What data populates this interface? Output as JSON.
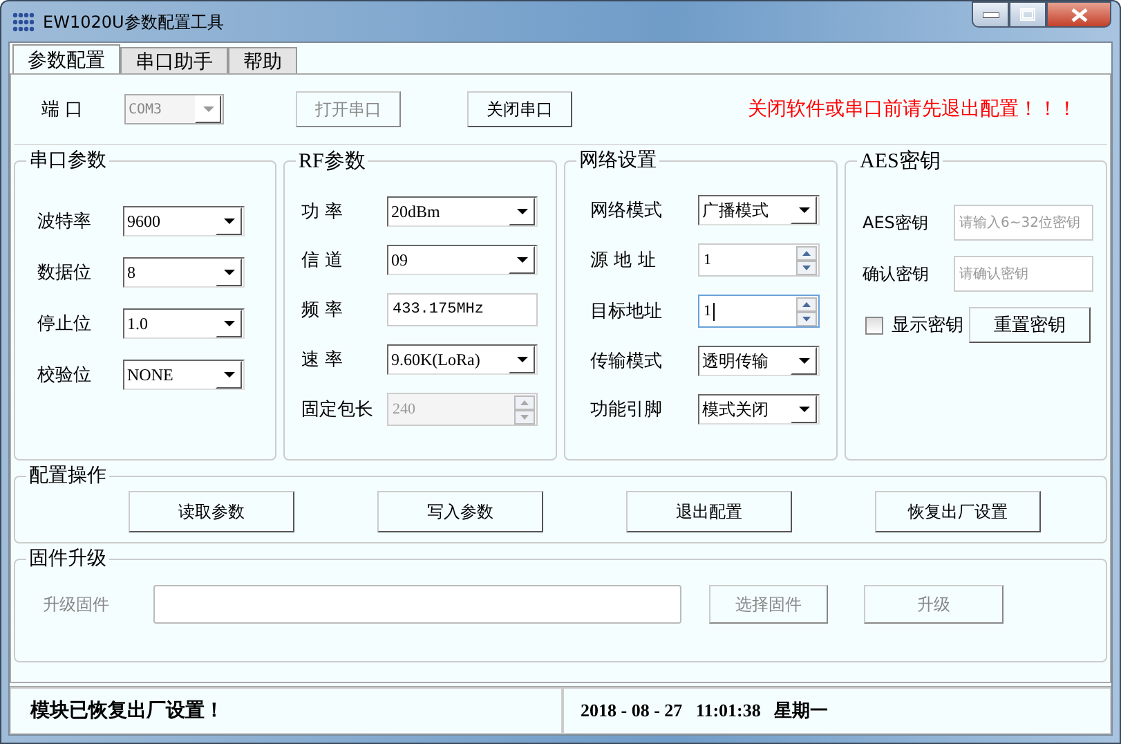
{
  "window": {
    "title": "EW1020U参数配置工具"
  },
  "tabs": [
    {
      "label": "参数配置",
      "selected": true
    },
    {
      "label": "串口助手",
      "selected": false
    },
    {
      "label": "帮助",
      "selected": false
    }
  ],
  "port": {
    "label": "端 口",
    "value": "COM3",
    "disabled": true
  },
  "port_buttons": [
    {
      "label": "打开串口",
      "disabled": true
    },
    {
      "label": "关闭串口",
      "disabled": false
    }
  ],
  "warning": "关闭软件或串口前请先退出配置！！！",
  "groups": [
    {
      "title": "串口参数",
      "fields": [
        {
          "label": "波特率",
          "kind": "select",
          "value": "9600",
          "disabled": false
        },
        {
          "label": "数据位",
          "kind": "select",
          "value": "8",
          "disabled": false
        },
        {
          "label": "停止位",
          "kind": "select",
          "value": "1.0",
          "disabled": false
        },
        {
          "label": "校验位",
          "kind": "select",
          "value": "NONE",
          "disabled": false
        }
      ]
    },
    {
      "title": "RF参数",
      "fields": [
        {
          "label": "功 率",
          "kind": "select",
          "value": "20dBm",
          "disabled": false
        },
        {
          "label": "信 道",
          "kind": "select",
          "value": "09",
          "disabled": false
        },
        {
          "label": "频 率",
          "kind": "text",
          "value": "433.175MHz"
        },
        {
          "label": "速 率",
          "kind": "select",
          "value": "9.60K(LoRa)",
          "disabled": false
        },
        {
          "label": "固定包长",
          "kind": "spin",
          "value": "240",
          "disabled": true,
          "focused": false
        }
      ]
    },
    {
      "title": "网络设置",
      "fields": [
        {
          "label": "网络模式",
          "kind": "select",
          "value": "广播模式",
          "disabled": false
        },
        {
          "label": "源 地 址",
          "kind": "spin",
          "value": "1",
          "disabled": false,
          "focused": false
        },
        {
          "label": "目标地址",
          "kind": "spin",
          "value": "1",
          "disabled": false,
          "focused": true
        },
        {
          "label": "传输模式",
          "kind": "select",
          "value": "透明传输",
          "disabled": false
        },
        {
          "label": "功能引脚",
          "kind": "select",
          "value": "模式关闭",
          "disabled": false
        }
      ]
    },
    {
      "title": "AES密钥",
      "fields": [
        {
          "label": "AES密钥",
          "kind": "text",
          "placeholder": "请输入6~32位密钥"
        },
        {
          "label": "确认密钥",
          "kind": "text",
          "placeholder": "请确认密钥"
        }
      ],
      "checkbox": {
        "label": "显示密钥",
        "checked": false
      },
      "button": {
        "label": "重置密钥",
        "disabled": false
      }
    }
  ],
  "operations": {
    "title": "配置操作",
    "buttons": [
      {
        "label": "读取参数",
        "disabled": false
      },
      {
        "label": "写入参数",
        "disabled": false
      },
      {
        "label": "退出配置",
        "disabled": false
      },
      {
        "label": "恢复出厂设置",
        "disabled": false
      }
    ]
  },
  "firmware": {
    "title": "固件升级",
    "label": "升级固件",
    "disabled": true,
    "buttons": [
      {
        "label": "选择固件",
        "disabled": true
      },
      {
        "label": "升级",
        "disabled": true
      }
    ]
  },
  "status_bar": {
    "message": "模块已恢复出厂设置！",
    "datetime": "2018 - 08 - 27   11:01:38   星期一"
  }
}
